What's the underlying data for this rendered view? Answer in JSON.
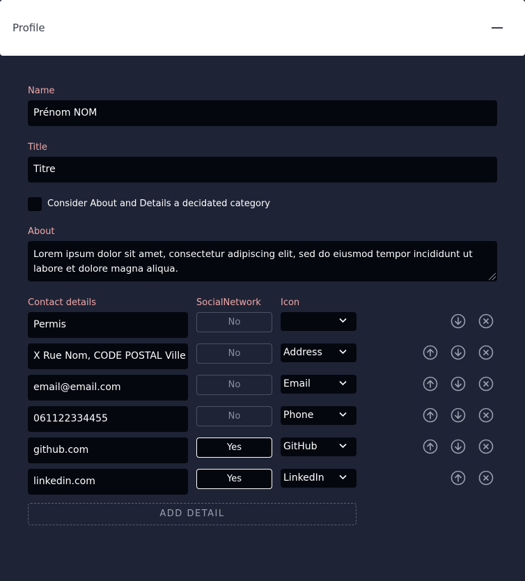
{
  "header": {
    "title": "Profile"
  },
  "name": {
    "label": "Name",
    "value": "Prénom NOM"
  },
  "title": {
    "label": "Title",
    "value": "Titre"
  },
  "category_checkbox": {
    "label": "Consider About and Details a decidated category",
    "checked": false
  },
  "about": {
    "label": "About",
    "value": "Lorem ipsum dolor sit amet, consectetur adipiscing elit, sed do eiusmod tempor incididunt ut labore et dolore magna aliqua."
  },
  "details": {
    "label": "Contact details",
    "col_social": "SocialNetwork",
    "col_icon": "Icon",
    "rows": [
      {
        "value": "Permis",
        "social": "No",
        "icon": ""
      },
      {
        "value": "X Rue Nom, CODE POSTAL Ville Région",
        "social": "No",
        "icon": "Address"
      },
      {
        "value": "email@email.com",
        "social": "No",
        "icon": "Email"
      },
      {
        "value": "061122334455",
        "social": "No",
        "icon": "Phone"
      },
      {
        "value": "github.com",
        "social": "Yes",
        "icon": "GitHub"
      },
      {
        "value": "linkedin.com",
        "social": "Yes",
        "icon": "LinkedIn"
      }
    ],
    "add_label": "ADD DETAIL"
  }
}
